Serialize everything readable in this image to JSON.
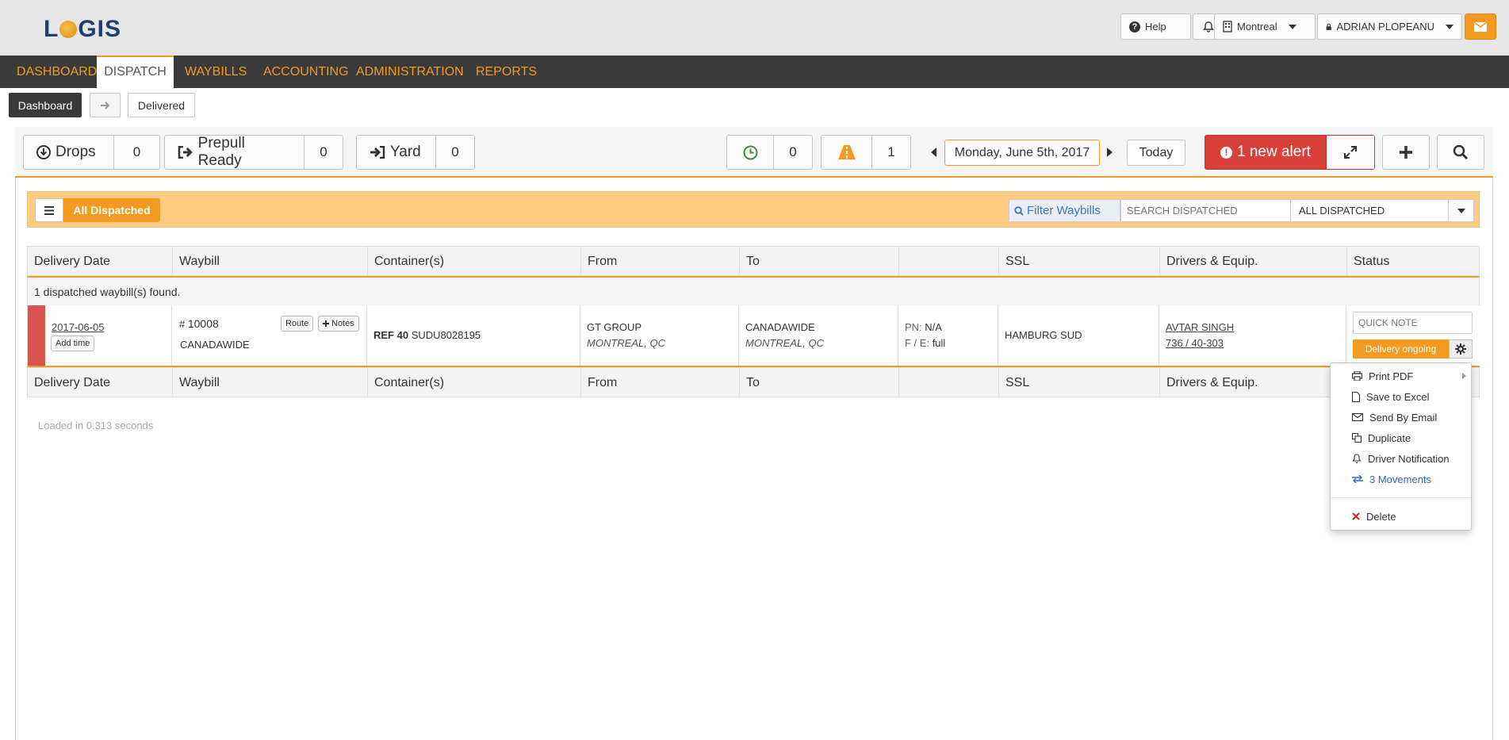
{
  "brand": {
    "logo_text_1": "L",
    "logo_text_2": "GIS"
  },
  "header": {
    "help": "Help",
    "location": "Montreal",
    "user": "ADRIAN PLOPEANU"
  },
  "nav": {
    "items": [
      "DASHBOARD",
      "DISPATCH",
      "WAYBILLS",
      "ACCOUNTING",
      "ADMINISTRATION",
      "REPORTS"
    ],
    "active": "DISPATCH"
  },
  "breadcrumb": {
    "first": "Dashboard",
    "current": "Delivered"
  },
  "toolbar": {
    "drops_label": "Drops",
    "drops_count": "0",
    "prepull_label": "Prepull Ready",
    "prepull_count": "0",
    "yard_label": "Yard",
    "yard_count": "0",
    "clock_count": "0",
    "road_count": "1",
    "date": "Monday, June 5th, 2017",
    "today": "Today",
    "alert": "1 new alert"
  },
  "filter": {
    "all_dispatched_btn": "All Dispatched",
    "filter_label": "Filter Waybills",
    "search_placeholder": "SEARCH DISPATCHED",
    "select_value": "ALL DISPATCHED"
  },
  "table": {
    "columns": [
      "Delivery Date",
      "Waybill",
      "Container(s)",
      "From",
      "To",
      "",
      "SSL",
      "Drivers & Equip.",
      "Status"
    ],
    "found_text": "1 dispatched waybill(s) found.",
    "row": {
      "delivery_date": "2017-06-05",
      "add_time": "Add time",
      "waybill_hash": "#",
      "waybill_no": "10008",
      "waybill_client": "CANADAWIDE",
      "route_btn": "Route",
      "notes_btn": "Notes",
      "container_ref": "REF 40",
      "container_no": "SUDU8028195",
      "from_name": "GT GROUP",
      "from_city": "MONTREAL, QC",
      "to_name": "CANADAWIDE",
      "to_city": "MONTREAL, QC",
      "pn_label": "PN:",
      "pn_value": "N/A",
      "fe_label": "F / E:",
      "fe_value": "full",
      "ssl": "HAMBURG SUD",
      "driver": "AVTAR SINGH",
      "equip": "736 / 40-303",
      "quick_note_placeholder": "QUICK NOTE",
      "status": "Delivery ongoing"
    }
  },
  "loaded": "Loaded in 0.313 seconds",
  "menu": {
    "items": [
      "Print PDF",
      "Save to Excel",
      "Send By Email",
      "Duplicate",
      "Driver Notification",
      "3 Movements"
    ],
    "delete": "Delete"
  },
  "colors": {
    "accent": "#f39a21",
    "nav_bg": "#3a3a3a",
    "alert_red": "#d9534f",
    "filter_bar": "#fecb80",
    "link_blue": "#2a6ebb"
  }
}
